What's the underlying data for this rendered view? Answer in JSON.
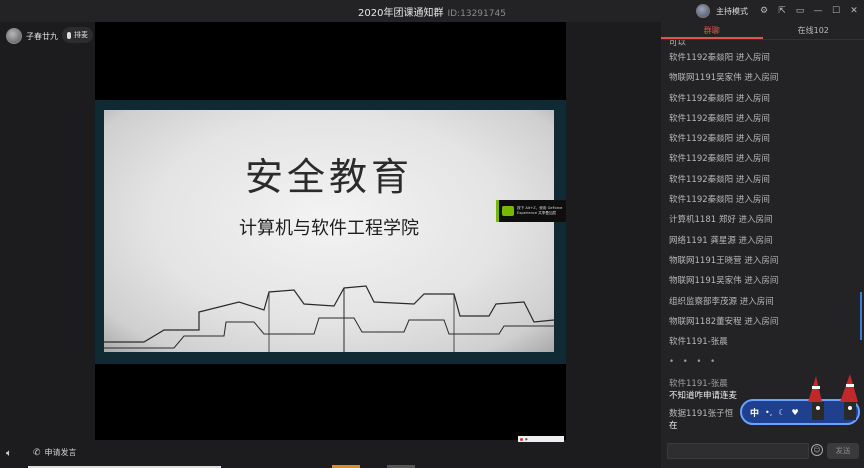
{
  "window": {
    "title": "2020年团课通知群",
    "room_id": "ID:13291745",
    "host_mode_label": "主持模式"
  },
  "user": {
    "name": "子春廿九",
    "mic_queue_label": "排麦"
  },
  "slide": {
    "title": "安全教育",
    "subtitle": "计算机与软件工程学院",
    "overlay_text": "按下 Alt+Z，使用 GeForce Experience 共享叠加层"
  },
  "bottom": {
    "apply_speak_label": "申请发言"
  },
  "chat": {
    "tabs": [
      {
        "label": "群聊",
        "active": true
      },
      {
        "label": "在线102",
        "active": false
      }
    ],
    "first_partial": "可以",
    "messages": [
      "软件1192秦燚阳 进入房间",
      "物联网1191吴家伟 进入房间",
      "软件1192秦燚阳 进入房间",
      "软件1192秦燚阳 进入房间",
      "软件1192秦燚阳 进入房间",
      "软件1192秦燚阳 进入房间",
      "软件1192秦燚阳 进入房间",
      "软件1192秦燚阳 进入房间",
      "计算机1181 郑好 进入房间",
      "网络1191 龚星源 进入房间",
      "物联网1191王晓营 进入房间",
      "物联网1191吴家伟 进入房间",
      "组织监察部李茂源 进入房间",
      "物联网1182董安程 进入房间",
      "软件1191-张晨"
    ],
    "dots": "• • • •",
    "sender": "软件1191-张晨",
    "sender_message": "不知道咋申请连麦",
    "last_sender": "数据1191张子恒",
    "last_message": "在",
    "input_placeholder": "",
    "send_label": "发送"
  },
  "ime": {
    "mode_char": "中"
  }
}
